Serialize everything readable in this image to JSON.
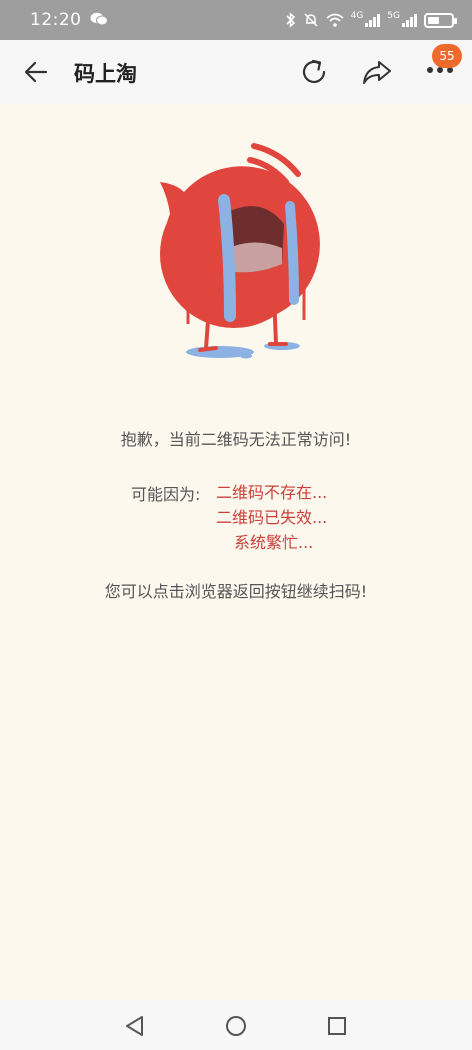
{
  "status_bar": {
    "time": "12:20",
    "network_4g": "4G",
    "network_5g": "5G"
  },
  "header": {
    "title": "码上淘",
    "badge_count": "55"
  },
  "content": {
    "main_message": "抱歉，当前二维码无法正常访问!",
    "reason_label": "可能因为:",
    "reasons": [
      "二维码不存在...",
      "二维码已失效...",
      "系统繁忙..."
    ],
    "hint_message": "您可以点击浏览器返回按钮继续扫码!"
  },
  "colors": {
    "background": "#fdf8ee",
    "reason_text": "#c9413a",
    "badge": "#ef6a2a",
    "mascot_red": "#e0463d"
  },
  "icons": {
    "wechat": "wechat-icon",
    "bluetooth": "bluetooth-icon",
    "mute": "bell-mute-icon",
    "wifi": "wifi-icon",
    "signal": "signal-icon",
    "battery": "battery-icon",
    "back": "arrow-left-icon",
    "refresh": "refresh-icon",
    "share": "share-icon",
    "more": "more-icon",
    "nav_back": "triangle-back-icon",
    "nav_home": "circle-home-icon",
    "nav_recent": "square-recent-icon"
  }
}
